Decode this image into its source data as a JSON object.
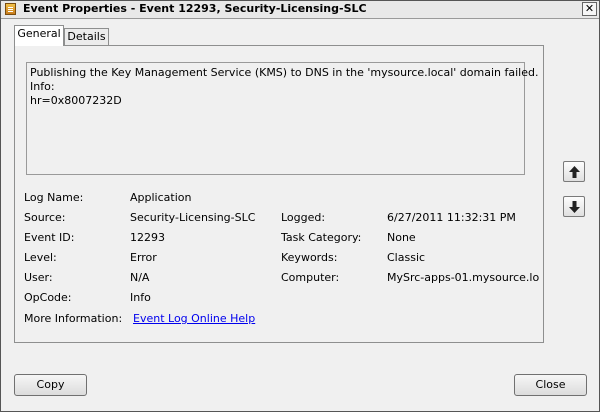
{
  "window": {
    "title": "Event Properties - Event 12293, Security-Licensing-SLC",
    "close_glyph": "✕"
  },
  "tabs": [
    {
      "label": "General",
      "active": true
    },
    {
      "label": "Details",
      "active": false
    }
  ],
  "description": {
    "lines": [
      "Publishing the Key Management Service (KMS) to DNS in the 'mysource.local' domain failed.",
      "Info:",
      "hr=0x8007232D"
    ]
  },
  "fields": {
    "log_name": {
      "label": "Log Name:",
      "value": "Application"
    },
    "source": {
      "label": "Source:",
      "value": "Security-Licensing-SLC"
    },
    "logged": {
      "label": "Logged:",
      "value": "6/27/2011 11:32:31 PM"
    },
    "event_id": {
      "label": "Event ID:",
      "value": "12293"
    },
    "task_category": {
      "label": "Task Category:",
      "value": "None"
    },
    "level": {
      "label": "Level:",
      "value": "Error"
    },
    "keywords": {
      "label": "Keywords:",
      "value": "Classic"
    },
    "user": {
      "label": "User:",
      "value": "N/A"
    },
    "computer": {
      "label": "Computer:",
      "value": "MySrc-apps-01.mysource.lo"
    },
    "opcode": {
      "label": "OpCode:",
      "value": "Info"
    },
    "more_info": {
      "label": "More Information:",
      "value": "Event Log Online Help"
    }
  },
  "buttons": {
    "copy": "Copy",
    "close": "Close",
    "up_icon": "arrow-up-icon",
    "down_icon": "arrow-down-icon"
  }
}
